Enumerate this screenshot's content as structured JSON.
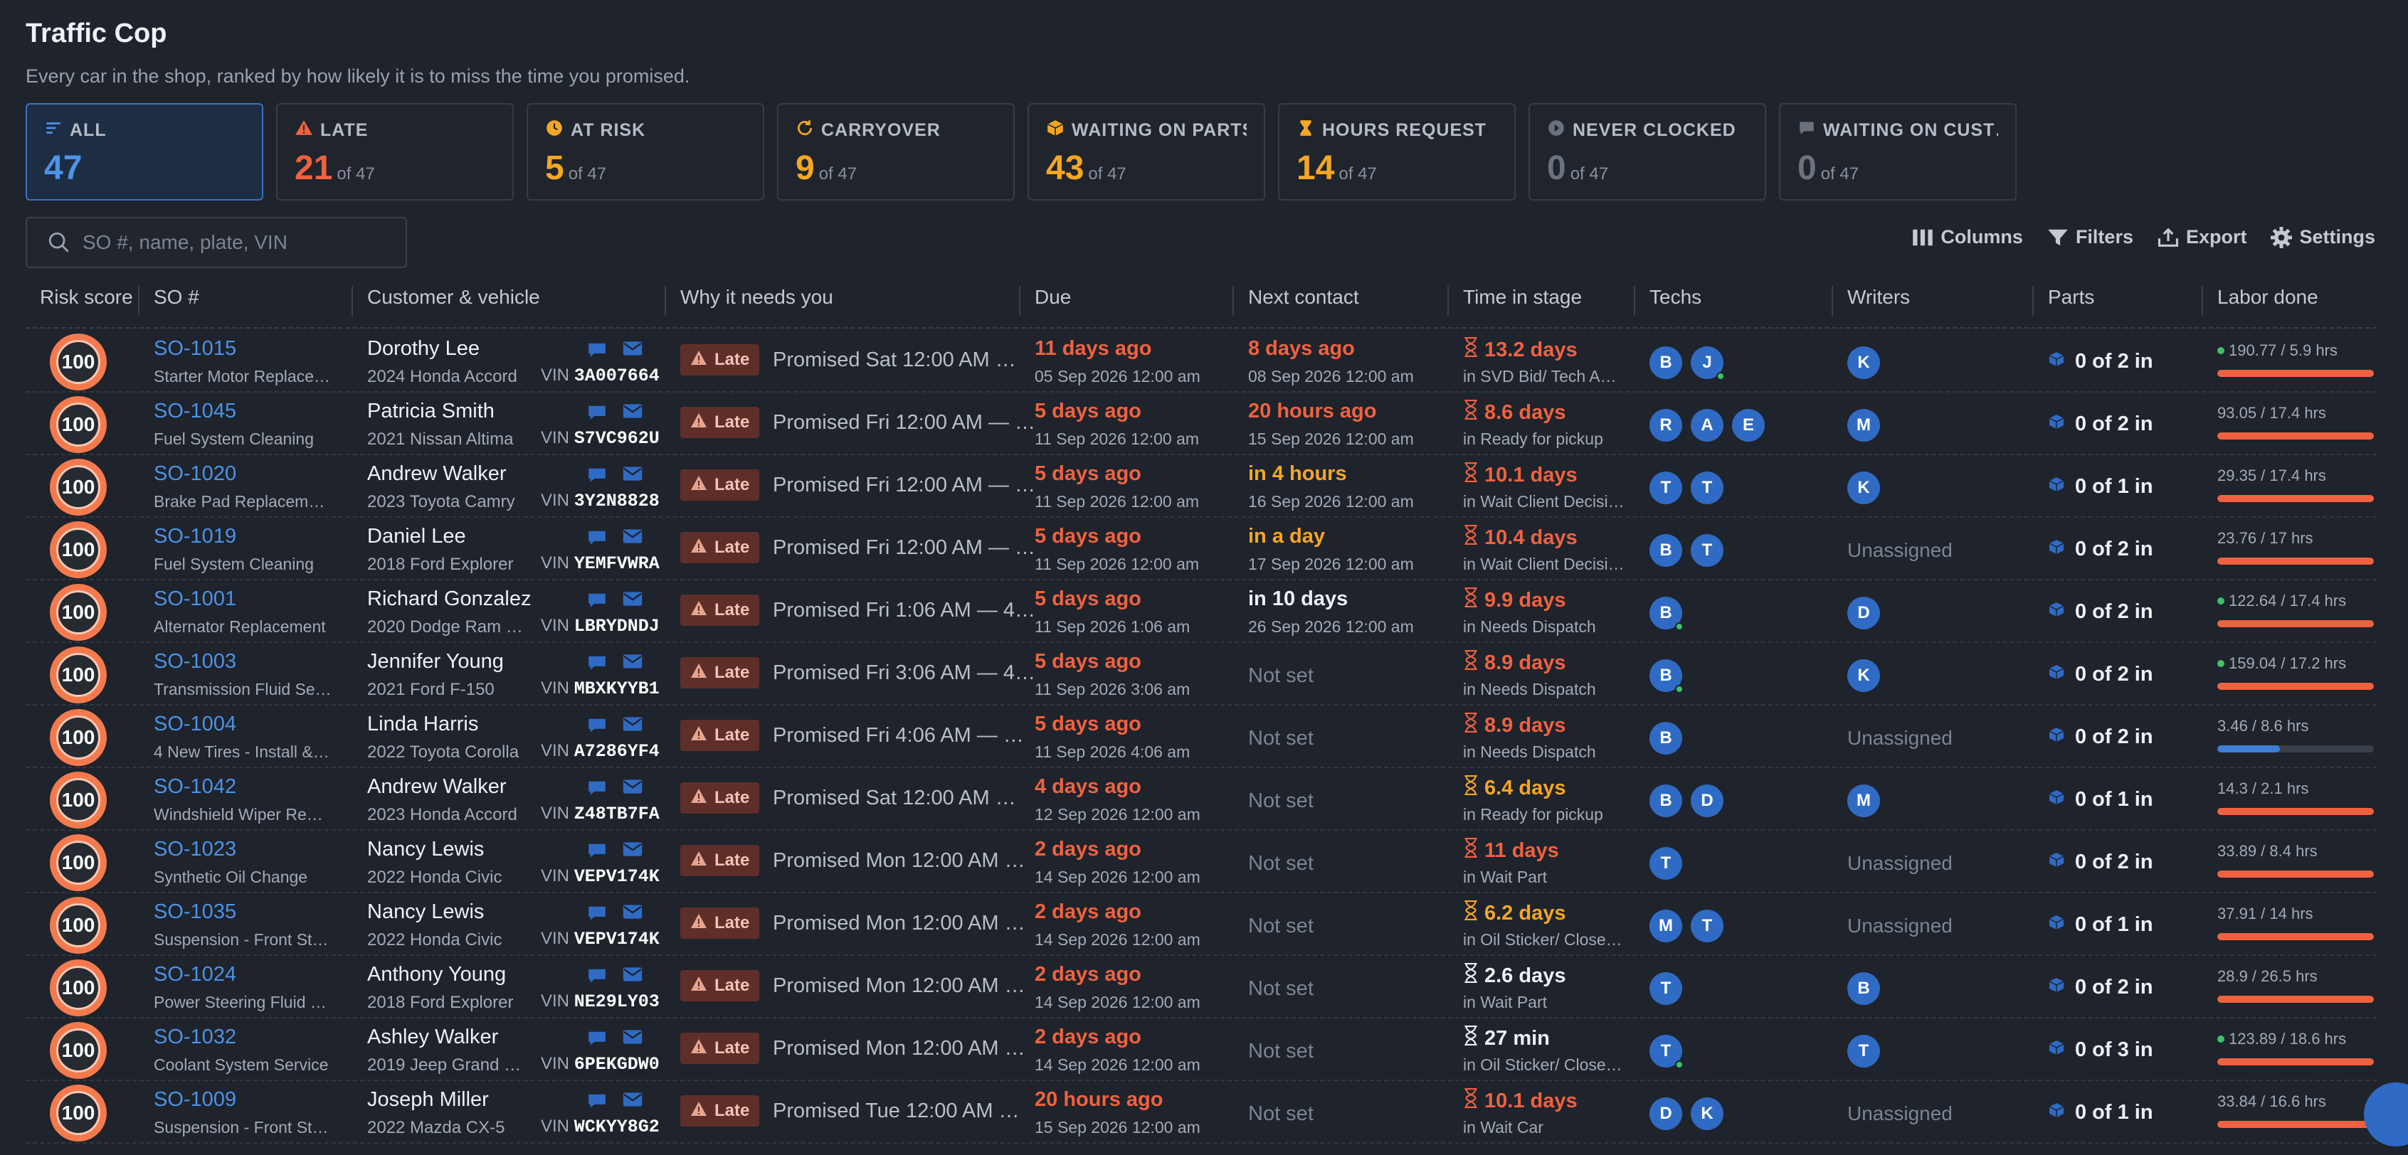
{
  "page": {
    "title": "Traffic Cop",
    "subtitle": "Every car in the shop, ranked by how likely it is to miss the time you promised."
  },
  "cards": [
    {
      "label": "ALL",
      "count": "47",
      "of": "",
      "color": "#4d93e6",
      "icon": "list-icon"
    },
    {
      "label": "LATE",
      "count": "21",
      "of": "of 47",
      "color": "#f0623f",
      "icon": "warning-icon"
    },
    {
      "label": "AT RISK",
      "count": "5",
      "of": "of 47",
      "color": "#f5a623",
      "icon": "clock-icon"
    },
    {
      "label": "CARRYOVER",
      "count": "9",
      "of": "of 47",
      "color": "#f5a623",
      "icon": "refresh-icon"
    },
    {
      "label": "WAITING ON PARTS",
      "count": "43",
      "of": "of 47",
      "color": "#f5a623",
      "icon": "box-icon"
    },
    {
      "label": "HOURS REQUEST",
      "count": "14",
      "of": "of 47",
      "color": "#f5a623",
      "icon": "hourglass-icon"
    },
    {
      "label": "NEVER CLOCKED",
      "count": "0",
      "of": "of 47",
      "color": "#6b727d",
      "icon": "play-icon"
    },
    {
      "label": "WAITING ON CUST…",
      "count": "0",
      "of": "of 47",
      "color": "#6b727d",
      "icon": "chat-icon"
    }
  ],
  "search": {
    "placeholder": "SO #, name, plate, VIN"
  },
  "toolbar": {
    "columns": "Columns",
    "filters": "Filters",
    "export": "Export",
    "settings": "Settings"
  },
  "columns": [
    "Risk score",
    "SO #",
    "Customer & vehicle",
    "Why it needs you",
    "Due",
    "Next contact",
    "Time in stage",
    "Techs",
    "Writers",
    "Parts",
    "Labor done"
  ],
  "colors": {
    "late": "#f0623f",
    "warn": "#f5a623",
    "link": "#4d93e6",
    "accent": "#2f6bc4"
  },
  "rows": [
    {
      "risk": "100",
      "so": "SO-1015",
      "service": "Starter Motor Replace…",
      "customer": "Dorothy Lee",
      "vehicle": "2024 Honda Accord",
      "vin_label": "VIN",
      "vin": "3A007664",
      "badge": "Late",
      "why": "Promised Sat 12:00 AM …",
      "due": "11 days ago",
      "due_date": "05 Sep 2026 12:00 am",
      "next": "8 days ago",
      "next_color": "late",
      "next_date": "08 Sep 2026 12:00 am",
      "tis": "13.2 days",
      "tis_color": "late",
      "stage": "in SVD Bid/ Tech A…",
      "techs": [
        {
          "i": "B",
          "dot": false
        },
        {
          "i": "J",
          "dot": true
        }
      ],
      "writers": [
        {
          "i": "K"
        }
      ],
      "writers_text": "",
      "parts": "0 of 2 in",
      "labor": "190.77 / 5.9 hrs",
      "labor_dot": true,
      "labor_pct": 1,
      "labor_blue": false
    },
    {
      "risk": "100",
      "so": "SO-1045",
      "service": "Fuel System Cleaning",
      "customer": "Patricia Smith",
      "vehicle": "2021 Nissan Altima",
      "vin_label": "VIN",
      "vin": "S7VC962U",
      "badge": "Late",
      "why": "Promised Fri 12:00 AM — …",
      "due": "5 days ago",
      "due_date": "11 Sep 2026 12:00 am",
      "next": "20 hours ago",
      "next_color": "late",
      "next_date": "15 Sep 2026 12:00 am",
      "tis": "8.6 days",
      "tis_color": "late",
      "stage": "in Ready for pickup",
      "techs": [
        {
          "i": "R",
          "dot": false
        },
        {
          "i": "A",
          "dot": false
        },
        {
          "i": "E",
          "dot": false
        }
      ],
      "writers": [
        {
          "i": "M"
        }
      ],
      "writers_text": "",
      "parts": "0 of 2 in",
      "labor": "93.05 / 17.4 hrs",
      "labor_dot": false,
      "labor_pct": 1,
      "labor_blue": false
    },
    {
      "risk": "100",
      "so": "SO-1020",
      "service": "Brake Pad Replacemen…",
      "customer": "Andrew Walker",
      "vehicle": "2023 Toyota Camry",
      "vin_label": "VIN",
      "vin": "3Y2N8828",
      "badge": "Late",
      "why": "Promised Fri 12:00 AM — …",
      "due": "5 days ago",
      "due_date": "11 Sep 2026 12:00 am",
      "next": "in 4 hours",
      "next_color": "warn",
      "next_date": "16 Sep 2026 12:00 am",
      "tis": "10.1 days",
      "tis_color": "late",
      "stage": "in Wait Client Decisi…",
      "techs": [
        {
          "i": "T",
          "dot": false
        },
        {
          "i": "T",
          "dot": false
        }
      ],
      "writers": [
        {
          "i": "K"
        }
      ],
      "writers_text": "",
      "parts": "0 of 1 in",
      "labor": "29.35 / 17.4 hrs",
      "labor_dot": false,
      "labor_pct": 1,
      "labor_blue": false
    },
    {
      "risk": "100",
      "so": "SO-1019",
      "service": "Fuel System Cleaning",
      "customer": "Daniel Lee",
      "vehicle": "2018 Ford Explorer",
      "vin_label": "VIN",
      "vin": "YEMFVWRA",
      "badge": "Late",
      "why": "Promised Fri 12:00 AM — …",
      "due": "5 days ago",
      "due_date": "11 Sep 2026 12:00 am",
      "next": "in a day",
      "next_color": "warn",
      "next_date": "17 Sep 2026 12:00 am",
      "tis": "10.4 days",
      "tis_color": "late",
      "stage": "in Wait Client Decisi…",
      "techs": [
        {
          "i": "B",
          "dot": false
        },
        {
          "i": "T",
          "dot": false
        }
      ],
      "writers": [],
      "writers_text": "Unassigned",
      "parts": "0 of 2 in",
      "labor": "23.76 / 17 hrs",
      "labor_dot": false,
      "labor_pct": 1,
      "labor_blue": false
    },
    {
      "risk": "100",
      "so": "SO-1001",
      "service": "Alternator Replacement",
      "customer": "Richard Gonzalez",
      "vehicle": "2020 Dodge Ram 15…",
      "vin_label": "VIN",
      "vin": "LBRYDNDJ",
      "badge": "Late",
      "why": "Promised Fri 1:06 AM — 4…",
      "due": "5 days ago",
      "due_date": "11 Sep 2026 1:06 am",
      "next": "in 10 days",
      "next_color": "plain",
      "next_date": "26 Sep 2026 12:00 am",
      "tis": "9.9 days",
      "tis_color": "late",
      "stage": "in Needs Dispatch",
      "techs": [
        {
          "i": "B",
          "dot": true
        }
      ],
      "writers": [
        {
          "i": "D"
        }
      ],
      "writers_text": "",
      "parts": "0 of 2 in",
      "labor": "122.64 / 17.4 hrs",
      "labor_dot": true,
      "labor_pct": 1,
      "labor_blue": false
    },
    {
      "risk": "100",
      "so": "SO-1003",
      "service": "Transmission Fluid Servi…",
      "customer": "Jennifer Young",
      "vehicle": "2021 Ford F-150",
      "vin_label": "VIN",
      "vin": "MBXKYYB1",
      "badge": "Late",
      "why": "Promised Fri 3:06 AM — 4…",
      "due": "5 days ago",
      "due_date": "11 Sep 2026 3:06 am",
      "next": "Not set",
      "next_color": "ns",
      "next_date": "",
      "tis": "8.9 days",
      "tis_color": "late",
      "stage": "in Needs Dispatch",
      "techs": [
        {
          "i": "B",
          "dot": true
        }
      ],
      "writers": [
        {
          "i": "K"
        }
      ],
      "writers_text": "",
      "parts": "0 of 2 in",
      "labor": "159.04 / 17.2 hrs",
      "labor_dot": true,
      "labor_pct": 1,
      "labor_blue": false
    },
    {
      "risk": "100",
      "so": "SO-1004",
      "service": "4 New Tires - Install & B…",
      "customer": "Linda Harris",
      "vehicle": "2022 Toyota Corolla",
      "vin_label": "VIN",
      "vin": "A7286YF4",
      "badge": "Late",
      "why": "Promised Fri 4:06 AM — …",
      "due": "5 days ago",
      "due_date": "11 Sep 2026 4:06 am",
      "next": "Not set",
      "next_color": "ns",
      "next_date": "",
      "tis": "8.9 days",
      "tis_color": "late",
      "stage": "in Needs Dispatch",
      "techs": [
        {
          "i": "B",
          "dot": false
        }
      ],
      "writers": [],
      "writers_text": "Unassigned",
      "parts": "0 of 2 in",
      "labor": "3.46 / 8.6 hrs",
      "labor_dot": false,
      "labor_pct": 0.4,
      "labor_blue": true
    },
    {
      "risk": "100",
      "so": "SO-1042",
      "service": "Windshield Wiper Repla…",
      "customer": "Andrew Walker",
      "vehicle": "2023 Honda Accord",
      "vin_label": "VIN",
      "vin": "Z48TB7FA",
      "badge": "Late",
      "why": "Promised Sat 12:00 AM …",
      "due": "4 days ago",
      "due_date": "12 Sep 2026 12:00 am",
      "next": "Not set",
      "next_color": "ns",
      "next_date": "",
      "tis": "6.4 days",
      "tis_color": "warn",
      "stage": "in Ready for pickup",
      "techs": [
        {
          "i": "B",
          "dot": false
        },
        {
          "i": "D",
          "dot": false
        }
      ],
      "writers": [
        {
          "i": "M"
        }
      ],
      "writers_text": "",
      "parts": "0 of 1 in",
      "labor": "14.3 / 2.1 hrs",
      "labor_dot": false,
      "labor_pct": 1,
      "labor_blue": false
    },
    {
      "risk": "100",
      "so": "SO-1023",
      "service": "Synthetic Oil Change",
      "customer": "Nancy Lewis",
      "vehicle": "2022 Honda Civic",
      "vin_label": "VIN",
      "vin": "VEPV174K",
      "badge": "Late",
      "why": "Promised Mon 12:00 AM …",
      "due": "2 days ago",
      "due_date": "14 Sep 2026 12:00 am",
      "next": "Not set",
      "next_color": "ns",
      "next_date": "",
      "tis": "11 days",
      "tis_color": "late",
      "stage": "in Wait Part",
      "techs": [
        {
          "i": "T",
          "dot": false
        }
      ],
      "writers": [],
      "writers_text": "Unassigned",
      "parts": "0 of 2 in",
      "labor": "33.89 / 8.4 hrs",
      "labor_dot": false,
      "labor_pct": 1,
      "labor_blue": false
    },
    {
      "risk": "100",
      "so": "SO-1035",
      "service": "Suspension - Front Stru…",
      "customer": "Nancy Lewis",
      "vehicle": "2022 Honda Civic",
      "vin_label": "VIN",
      "vin": "VEPV174K",
      "badge": "Late",
      "why": "Promised Mon 12:00 AM …",
      "due": "2 days ago",
      "due_date": "14 Sep 2026 12:00 am",
      "next": "Not set",
      "next_color": "ns",
      "next_date": "",
      "tis": "6.2 days",
      "tis_color": "warn",
      "stage": "in Oil Sticker/ Close…",
      "techs": [
        {
          "i": "M",
          "dot": false
        },
        {
          "i": "T",
          "dot": false
        }
      ],
      "writers": [],
      "writers_text": "Unassigned",
      "parts": "0 of 1 in",
      "labor": "37.91 / 14 hrs",
      "labor_dot": false,
      "labor_pct": 1,
      "labor_blue": false
    },
    {
      "risk": "100",
      "so": "SO-1024",
      "service": "Power Steering Fluid Le…",
      "customer": "Anthony Young",
      "vehicle": "2018 Ford Explorer",
      "vin_label": "VIN",
      "vin": "NE29LY03",
      "badge": "Late",
      "why": "Promised Mon 12:00 AM …",
      "due": "2 days ago",
      "due_date": "14 Sep 2026 12:00 am",
      "next": "Not set",
      "next_color": "ns",
      "next_date": "",
      "tis": "2.6 days",
      "tis_color": "plain",
      "stage": "in Wait Part",
      "techs": [
        {
          "i": "T",
          "dot": false
        }
      ],
      "writers": [
        {
          "i": "B"
        }
      ],
      "writers_text": "",
      "parts": "0 of 2 in",
      "labor": "28.9 / 26.5 hrs",
      "labor_dot": false,
      "labor_pct": 1,
      "labor_blue": false
    },
    {
      "risk": "100",
      "so": "SO-1032",
      "service": "Coolant System Service",
      "customer": "Ashley Walker",
      "vehicle": "2019 Jeep Grand Ch…",
      "vin_label": "VIN",
      "vin": "6PEKGDW0",
      "badge": "Late",
      "why": "Promised Mon 12:00 AM …",
      "due": "2 days ago",
      "due_date": "14 Sep 2026 12:00 am",
      "next": "Not set",
      "next_color": "ns",
      "next_date": "",
      "tis": "27 min",
      "tis_color": "plain",
      "stage": "in Oil Sticker/ Close…",
      "techs": [
        {
          "i": "T",
          "dot": true
        }
      ],
      "writers": [
        {
          "i": "T"
        }
      ],
      "writers_text": "",
      "parts": "0 of 3 in",
      "labor": "123.89 / 18.6 hrs",
      "labor_dot": true,
      "labor_pct": 1,
      "labor_blue": false
    },
    {
      "risk": "100",
      "so": "SO-1009",
      "service": "Suspension - Front Stru…",
      "customer": "Joseph Miller",
      "vehicle": "2022 Mazda CX-5",
      "vin_label": "VIN",
      "vin": "WCKYY8G2",
      "badge": "Late",
      "why": "Promised Tue 12:00 AM …",
      "due": "20 hours ago",
      "due_date": "15 Sep 2026 12:00 am",
      "next": "Not set",
      "next_color": "ns",
      "next_date": "",
      "tis": "10.1 days",
      "tis_color": "late",
      "stage": "in Wait Car",
      "techs": [
        {
          "i": "D",
          "dot": false
        },
        {
          "i": "K",
          "dot": false
        }
      ],
      "writers": [],
      "writers_text": "Unassigned",
      "parts": "0 of 1 in",
      "labor": "33.84 / 16.6 hrs",
      "labor_dot": false,
      "labor_pct": 1,
      "labor_blue": false
    }
  ]
}
